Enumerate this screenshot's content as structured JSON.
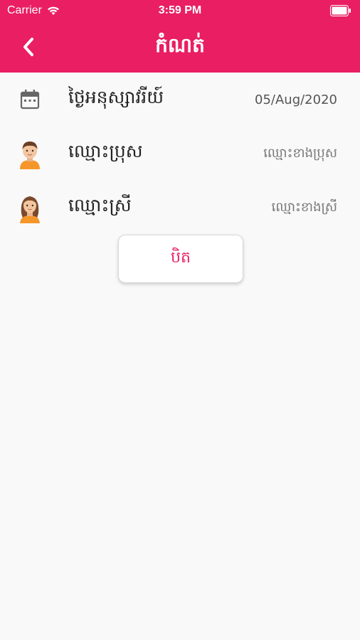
{
  "status_bar": {
    "carrier": "Carrier",
    "time": "3:59 PM"
  },
  "nav": {
    "title": "កំណត់",
    "back_icon": "chevron-left-icon"
  },
  "rows": [
    {
      "icon": "calendar-icon",
      "label": "ថ្ងៃអនុស្សាវរីយ៍",
      "value": "05/Aug/2020"
    },
    {
      "icon": "male-avatar-icon",
      "label": "ឈ្មោះប្រុស",
      "value": "ឈ្មោះខាងប្រុស"
    },
    {
      "icon": "female-avatar-icon",
      "label": "ឈ្មោះស្រី",
      "value": "ឈ្មោះខាងស្រី"
    }
  ],
  "close_button": {
    "label": "បិត"
  },
  "colors": {
    "accent": "#e91e63",
    "background": "#f9f9f9"
  }
}
